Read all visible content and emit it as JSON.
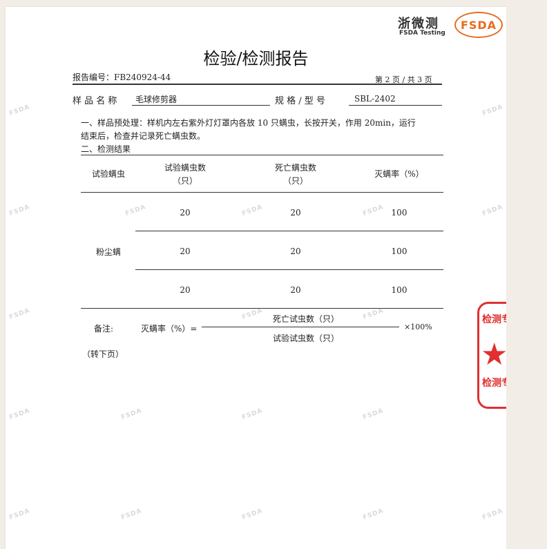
{
  "header": {
    "logo_cn": "浙微测",
    "logo_en": "FSDA Testing",
    "logo_badge": "FSDA"
  },
  "watermark": "FSDA",
  "title": "检验/检测报告",
  "report": {
    "number_label": "报告编号：FB240924-44",
    "page_info": "第 2 页 / 共 3 页",
    "sample_label": "样 品 名 称",
    "sample_value": "毛球修剪器",
    "spec_label": "规 格 / 型 号",
    "spec_value": "SBL-2402"
  },
  "sections": {
    "pretreat_line1": "一、样品预处理：样机内左右紫外灯灯罩内各放 10 只螨虫，长按开关，作用 20min，运行",
    "pretreat_line2": "结束后，检查并记录死亡螨虫数。",
    "results_heading": "二、检测结果"
  },
  "table": {
    "headers": [
      {
        "line1": "试验螨虫",
        "line2": ""
      },
      {
        "line1": "试验螨虫数",
        "line2": "（只）"
      },
      {
        "line1": "死亡螨虫数",
        "line2": "（只）"
      },
      {
        "line1": "灭螨率（%）",
        "line2": ""
      }
    ],
    "species": "粉尘螨",
    "rows": [
      {
        "tested": "20",
        "dead": "20",
        "rate": "100"
      },
      {
        "tested": "20",
        "dead": "20",
        "rate": "100"
      },
      {
        "tested": "20",
        "dead": "20",
        "rate": "100"
      }
    ]
  },
  "note": {
    "label": "备注:",
    "formula_left": "灭螨率（%）=",
    "numerator": "死亡试虫数（只）",
    "denominator": "试验试虫数（只）",
    "multiplier": "×100%"
  },
  "continued": "（转下页）",
  "stamp": {
    "top_text": "检测专",
    "bottom_text": "检测专"
  }
}
